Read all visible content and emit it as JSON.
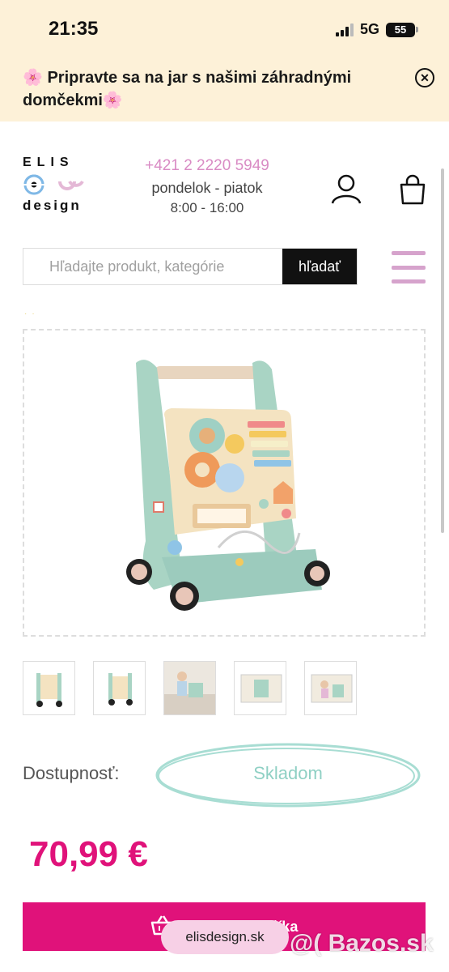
{
  "status_bar": {
    "time": "21:35",
    "network": "5G",
    "battery": "55"
  },
  "promo": {
    "text": "🌸 Pripravte sa na jar s našimi záhradnými domčekmi🌸",
    "close_icon": "close-circle-icon"
  },
  "logo": {
    "top": "ELIS",
    "bottom": "design"
  },
  "contact": {
    "phone": "+421 2 2220 5949",
    "days": "pondelok - piatok",
    "hours": "8:00 - 16:00"
  },
  "search": {
    "placeholder": "Hľadajte produkt, kategórie",
    "button_label": "hľadať"
  },
  "product": {
    "image_icon": "wooden-activity-walker-image",
    "thumbnails": [
      "walker-front",
      "walker-side",
      "child-with-walker",
      "walker-box",
      "walker-box-child"
    ]
  },
  "availability": {
    "label": "Dostupnosť:",
    "value": "Skladom"
  },
  "price": "70,99 €",
  "cart": {
    "label": "Vložiť do košíka",
    "icon": "basket-icon"
  },
  "overlay": {
    "url": "elisdesign.sk",
    "watermark": "@( Bazos.sk"
  },
  "colors": {
    "accent": "#e0127a",
    "banner_bg": "#fdf1d8",
    "phone": "#d98bc4",
    "menu": "#d6a3cc",
    "availability": "#8fd0c4"
  }
}
